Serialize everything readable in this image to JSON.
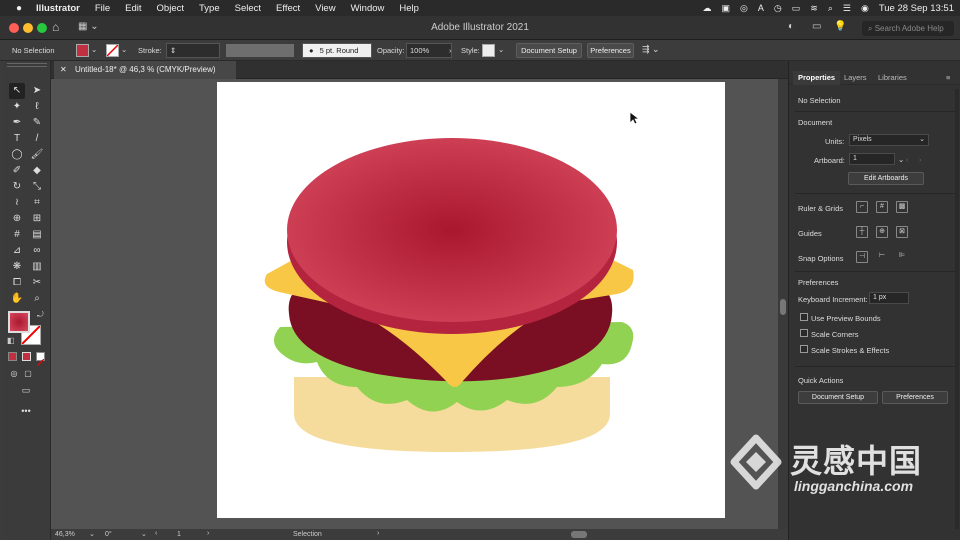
{
  "menubar": {
    "app": "Illustrator",
    "items": [
      "File",
      "Edit",
      "Object",
      "Type",
      "Select",
      "Effect",
      "View",
      "Window",
      "Help"
    ],
    "datetime": "Tue 28 Sep  13:51"
  },
  "window": {
    "title": "Adobe Illustrator 2021",
    "search_placeholder": "Search Adobe Help"
  },
  "control": {
    "selection": "No Selection",
    "stroke_label": "Stroke:",
    "brush": "5 pt. Round",
    "opacity_label": "Opacity:",
    "opacity": "100%",
    "style_label": "Style:",
    "document_setup": "Document Setup",
    "preferences": "Preferences"
  },
  "doc": {
    "tab": "Untitled-18* @ 46,3 % (CMYK/Preview)"
  },
  "status": {
    "zoom": "46,3%",
    "rotation": "0°",
    "artboard": "1",
    "tool": "Selection"
  },
  "panel": {
    "tabs": [
      "Properties",
      "Layers",
      "Libraries"
    ],
    "selection": "No Selection",
    "document_label": "Document",
    "units_label": "Units:",
    "units": "Pixels",
    "artboard_label": "Artboard:",
    "artboard": "1",
    "edit_artboards": "Edit Artboards",
    "ruler_grids": "Ruler & Grids",
    "guides": "Guides",
    "snap_options": "Snap Options",
    "preferences_label": "Preferences",
    "keyboard_increment_label": "Keyboard Increment:",
    "keyboard_increment": "1 px",
    "use_preview_bounds": "Use Preview Bounds",
    "scale_corners": "Scale Corners",
    "scale_strokes": "Scale Strokes & Effects",
    "quick_actions": "Quick Actions",
    "qa_document_setup": "Document Setup",
    "qa_preferences": "Preferences"
  },
  "watermark": {
    "cn": "灵感中国",
    "url": "lingganchina.com"
  },
  "colors": {
    "bun_top": "#c93a4f",
    "bun_edge": "#b5243f",
    "cheese": "#f7c745",
    "patty": "#7a0e22",
    "lettuce": "#92d253",
    "bun_bottom": "#f6dc9c",
    "fill_swatch": "#c03040"
  }
}
